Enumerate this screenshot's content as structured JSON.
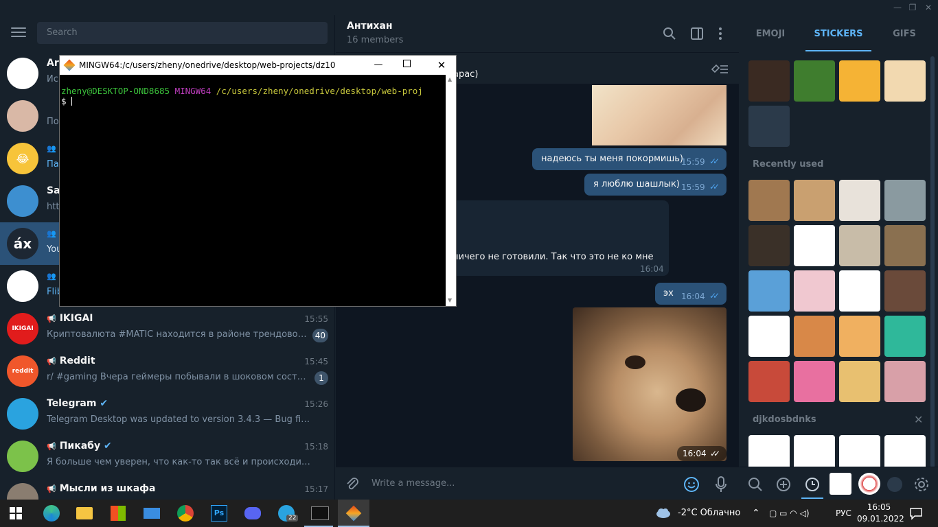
{
  "window": {
    "minimize": "—",
    "maximize": "❐",
    "close": "✕"
  },
  "left": {
    "search_placeholder": "Search",
    "chats": [
      {
        "name": "Ar",
        "time": "",
        "preview": "Ис",
        "badge": "",
        "avatar_text": "",
        "avatar_color": "#ffffff",
        "group": false
      },
      {
        "name": "",
        "time": "",
        "preview": "По",
        "badge": "",
        "avatar_text": "",
        "avatar_color": "#d9b8a6",
        "group": false
      },
      {
        "name": "",
        "time": "",
        "preview": "Пап",
        "badge": "",
        "avatar_text": "😂",
        "avatar_color": "#f7c43a",
        "group": true
      },
      {
        "name": "Sav",
        "time": "",
        "preview": "htt",
        "badge": "",
        "avatar_text": "",
        "avatar_color": "#3d8fd0",
        "group": false
      },
      {
        "name": "",
        "time": "",
        "preview": "You",
        "badge": "",
        "avatar_text": "áx",
        "avatar_color": "#1d2733",
        "group": true
      },
      {
        "name": "",
        "time": "",
        "preview": "Flib",
        "badge": "",
        "avatar_text": "",
        "avatar_color": "#ffffff",
        "group": true
      },
      {
        "name": "IKIGAI",
        "time": "15:55",
        "preview": "Криптовалюта #MATIC находится в районе трендовой л...",
        "badge": "40",
        "avatar_text": "IKIGAI",
        "avatar_color": "#e11c1c",
        "group": false
      },
      {
        "name": "Reddit",
        "time": "15:45",
        "preview": "r/ #gaming Вчера геймеры побывали в шоковом состоян...",
        "badge": "1",
        "avatar_text": "reddit",
        "avatar_color": "#f0572b",
        "group": false
      },
      {
        "name": "Telegram",
        "time": "15:26",
        "preview": "Telegram Desktop was updated to version 3.4.3 — Bug fixes and ot...",
        "badge": "",
        "avatar_text": "",
        "avatar_color": "#2aa3df",
        "group": false
      },
      {
        "name": "Пикабу",
        "time": "15:18",
        "preview": "Я больше чем уверен, что как-то так всё и происходит. Друг...",
        "badge": "",
        "avatar_text": "",
        "avatar_color": "#7cc24a",
        "group": false
      },
      {
        "name": "Мысли из шкафа",
        "time": "15:17",
        "preview": "",
        "badge": "",
        "avatar_text": "",
        "avatar_color": "#8a7d70",
        "group": false
      }
    ]
  },
  "chat": {
    "title": "Антихан",
    "members": "16 members",
    "pinned_fragment": "дарас)",
    "messages": [
      {
        "text": "надеюсь ты меня покормишь)",
        "time": "15:59"
      },
      {
        "text": "я люблю шашлык)",
        "time": "15:59"
      },
      {
        "text": "ничего не готовили. Так что это не ко мне",
        "time": "16:04"
      },
      {
        "text": "эх",
        "time": "16:04"
      },
      {
        "text": "",
        "time": "16:04"
      }
    ],
    "composer_placeholder": "Write a message..."
  },
  "right": {
    "tabs": [
      "EMOJI",
      "STICKERS",
      "GIFS"
    ],
    "active_tab": "STICKERS",
    "recent_title": "Recently used",
    "set_title": "djkdosbdnks"
  },
  "terminal": {
    "title": "MINGW64:/c/users/zheny/onedrive/desktop/web-projects/dz10",
    "user": "zheny@DESKTOP-OND8685",
    "env": "MINGW64",
    "path": "/c/users/zheny/onedrive/desktop/web-proj",
    "prompt": "$"
  },
  "taskbar": {
    "weather": "-2°C  Облачно",
    "lang": "РУС",
    "time": "16:05",
    "date": "09.01.2022",
    "telegram_badge": "22"
  },
  "colors": {
    "accent": "#5eb5f7",
    "bubble": "#2b5278",
    "panel": "#17212b",
    "bg": "#0e1621"
  }
}
